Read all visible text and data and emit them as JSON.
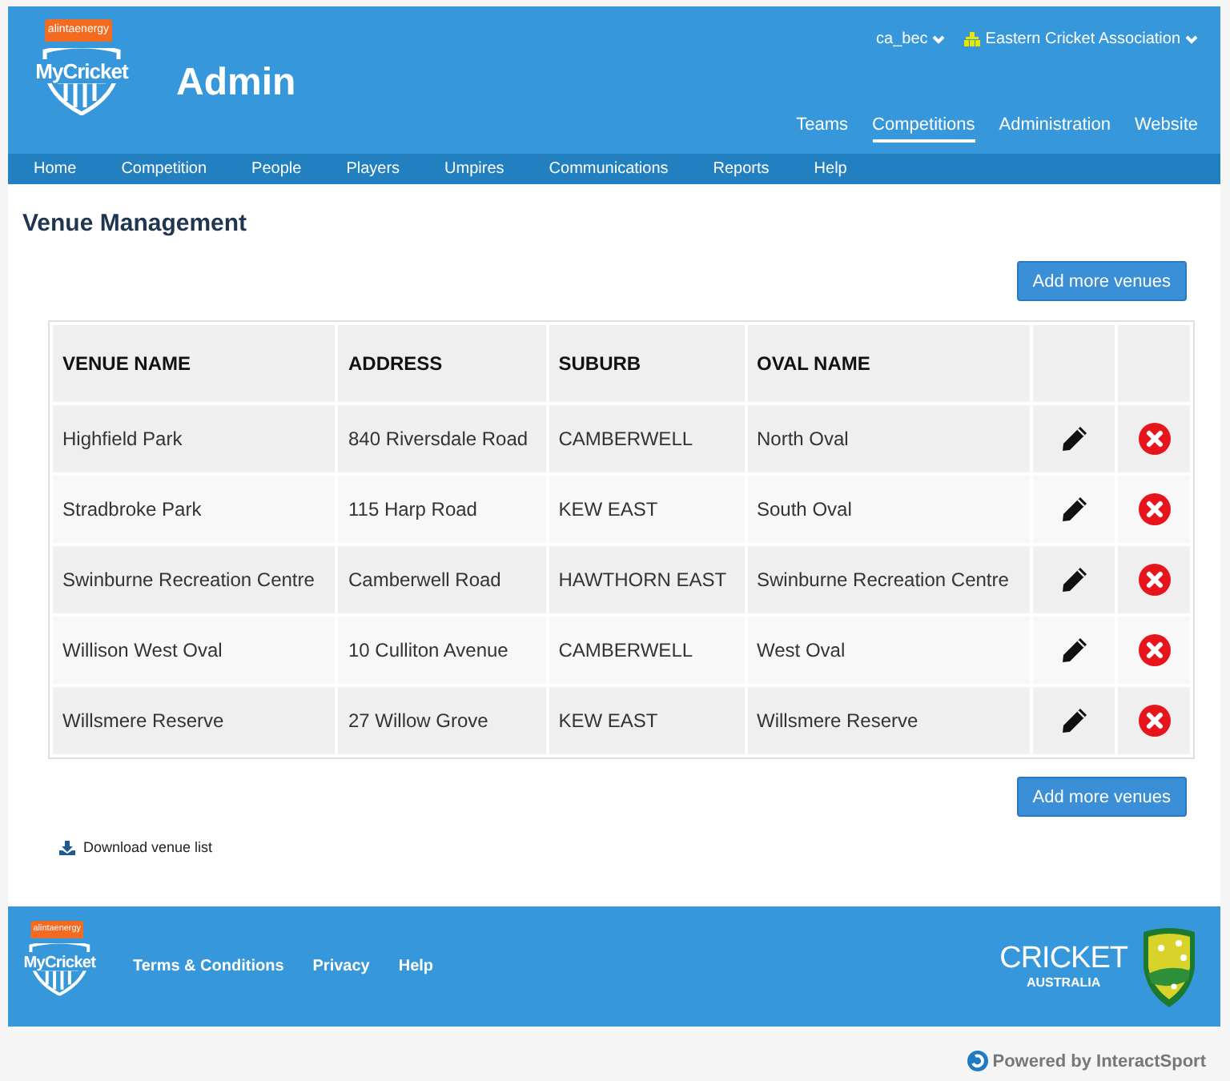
{
  "header": {
    "sponsor": "alintaenergy",
    "logo_text": "MyCricket",
    "title": "Admin",
    "user_menu": "ca_bec",
    "org_menu": "Eastern Cricket Association",
    "top_nav": [
      {
        "label": "Teams",
        "selected": false
      },
      {
        "label": "Competitions",
        "selected": true
      },
      {
        "label": "Administration",
        "selected": false
      },
      {
        "label": "Website",
        "selected": false
      }
    ]
  },
  "main_nav": [
    "Home",
    "Competition",
    "People",
    "Players",
    "Umpires",
    "Communications",
    "Reports",
    "Help"
  ],
  "page_title": "Venue Management",
  "add_button_top": "Add more venues",
  "table": {
    "columns": [
      "VENUE NAME",
      "ADDRESS",
      "SUBURB",
      "OVAL NAME"
    ],
    "rows": [
      [
        "Highfield Park",
        "840 Riversdale Road",
        "CAMBERWELL",
        "North Oval"
      ],
      [
        "Stradbroke Park",
        "115 Harp Road",
        "KEW EAST",
        "South Oval"
      ],
      [
        "Swinburne Recreation Centre",
        "Camberwell Road",
        "HAWTHORN EAST",
        "Swinburne Recreation Centre"
      ],
      [
        "Willison West Oval",
        "10 Culliton Avenue",
        "CAMBERWELL",
        "West Oval"
      ],
      [
        "Willsmere Reserve",
        "27 Willow Grove",
        "KEW EAST",
        "Willsmere Reserve"
      ]
    ]
  },
  "add_button_bottom": "Add more venues",
  "download_link": "Download venue list",
  "footer": {
    "sponsor": "alintaenergy",
    "logo_text": "MyCricket",
    "links": [
      "Terms & Conditions",
      "Privacy",
      "Help"
    ],
    "partner_main": "CRICKET",
    "partner_sub": "AUSTRALIA"
  },
  "powered_by": "Powered by InteractSport"
}
